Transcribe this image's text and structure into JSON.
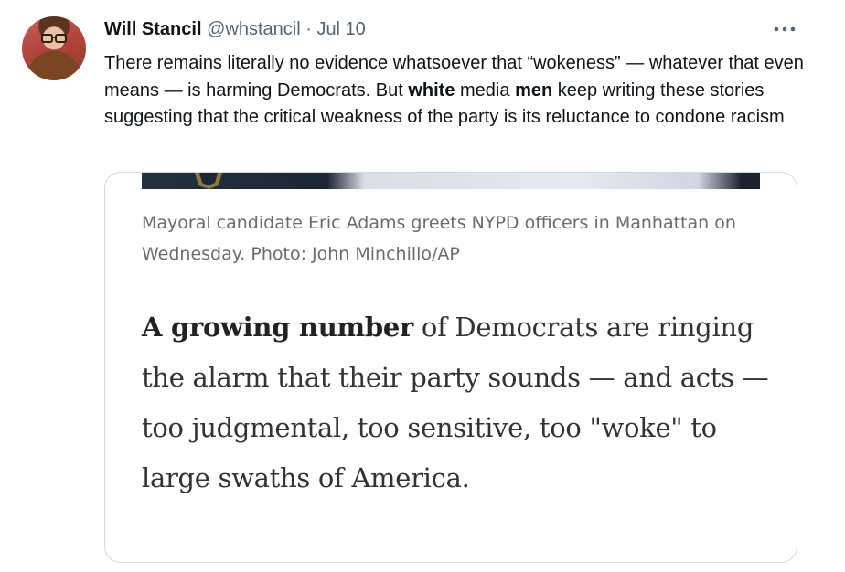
{
  "tweet": {
    "author_name": "Will Stancil",
    "handle": "@whstancil",
    "separator": "·",
    "date": "Jul 10",
    "text_parts": [
      "There remains literally no evidence whatsoever that “wokeness” — whatever that even means — is harming Democrats. But ",
      "white",
      " media ",
      "men",
      " keep writing these stories suggesting that the critical weakness of the party is its reluctance to condone racism"
    ]
  },
  "card": {
    "caption": "Mayoral candidate Eric Adams greets NYPD officers in Manhattan on Wednesday. Photo: John Minchillo/AP",
    "quote_bold": "A growing number",
    "quote_rest": " of Democrats are ringing the alarm that their party sounds — and acts — too judgmental, too sensitive, too \"woke\" to large swaths of America."
  },
  "icons": {
    "avatar": "avatar-photo",
    "more": "more-horizontal-icon"
  },
  "colors": {
    "text_primary": "#0f1419",
    "text_secondary": "#536471",
    "card_border": "#cfd9de",
    "caption": "#6b6b6b",
    "quote": "#333333"
  }
}
